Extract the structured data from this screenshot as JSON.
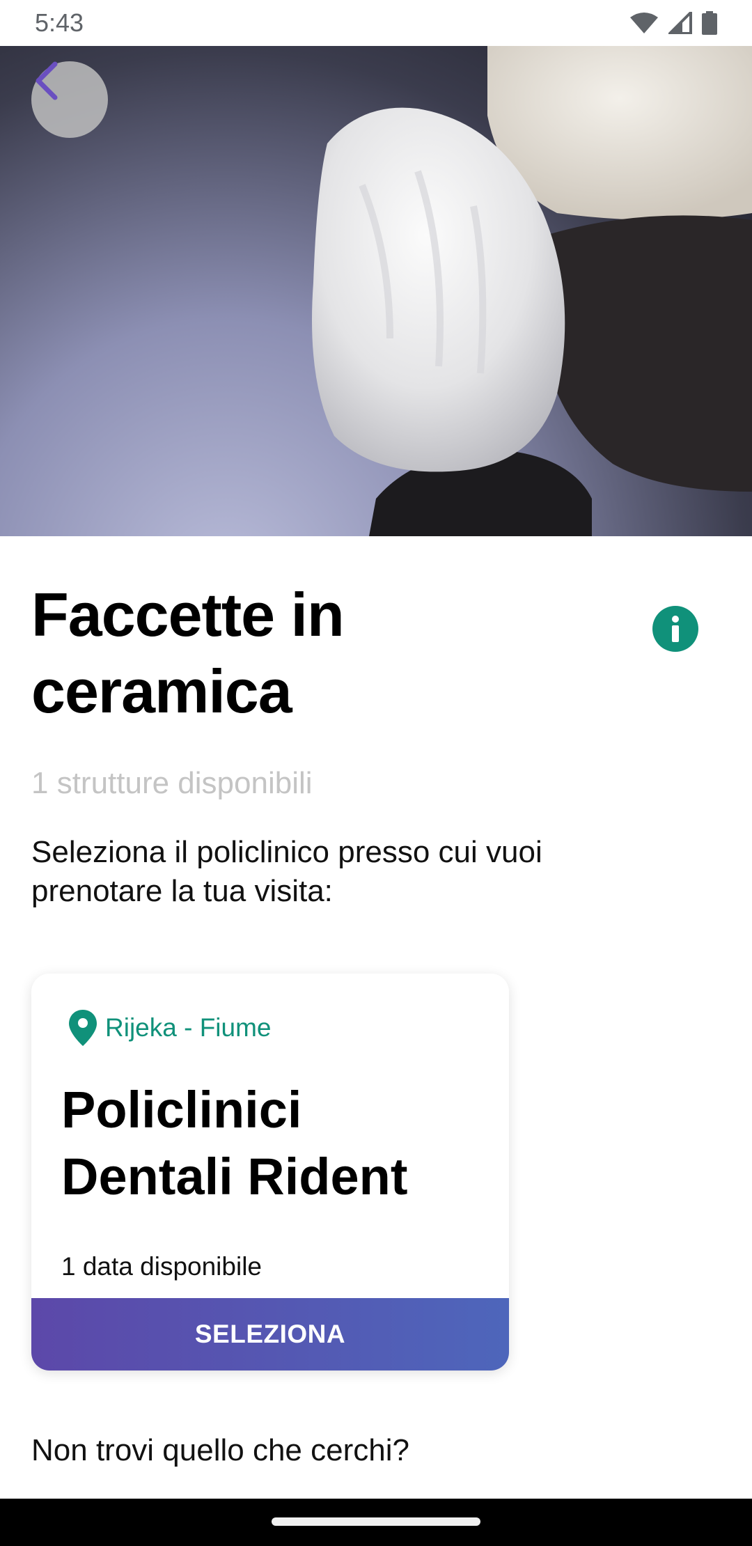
{
  "status_bar": {
    "time": "5:43",
    "icons": [
      "wifi-icon",
      "signal-icon",
      "battery-icon"
    ]
  },
  "hero": {
    "image_subject": "ceramic veneer tooth close-up"
  },
  "main": {
    "title": "Faccette in ceramica",
    "available_count": "1 strutture disponibili",
    "instruction": "Seleziona il policlinico presso cui vuoi prenotare la tua visita:"
  },
  "clinic_card": {
    "location": "Rijeka - Fiume",
    "name": "Policlinici Dentali Rident",
    "dates_available": "1 data disponibile",
    "select_label": "SELEZIONA"
  },
  "footer": {
    "question": "Non trovi quello che cerchi?"
  },
  "colors": {
    "accent_green": "#10917a",
    "button_gradient_start": "#5c48a9",
    "button_gradient_end": "#4e66bb",
    "back_arrow": "#6a4fc0",
    "subtitle_gray": "#c4c4c4"
  }
}
